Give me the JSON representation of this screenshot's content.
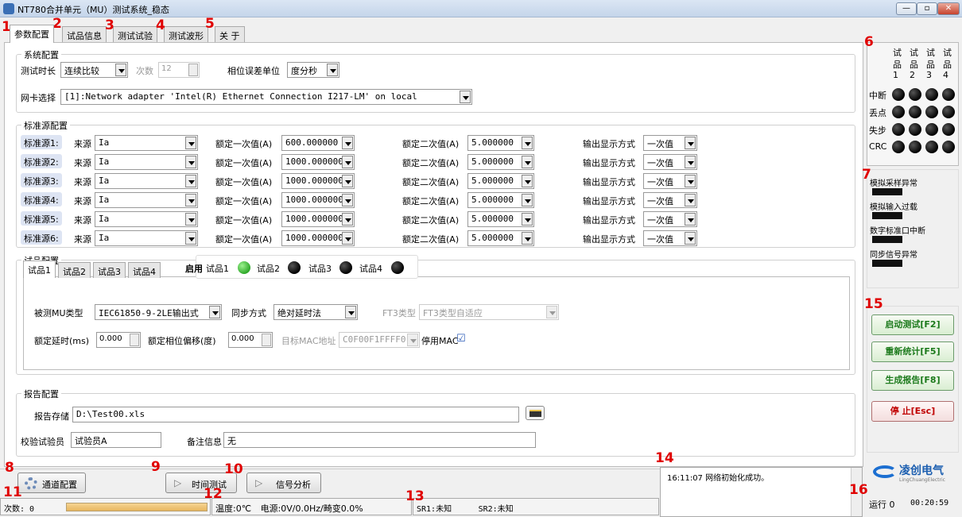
{
  "window": {
    "title": "NT780合并单元（MU）测试系统_稳态",
    "min": "—",
    "max": "▫",
    "close": "✕"
  },
  "tabs": [
    "参数配置",
    "试品信息",
    "测试试验",
    "测试波形",
    "关 于"
  ],
  "system": {
    "label": "系统配置",
    "duration_label": "测试时长",
    "duration_value": "连续比较",
    "count_label": "次数",
    "count_value": "12",
    "phase_unit_label": "相位误差单位",
    "phase_unit_value": "度分秒",
    "nic_label": "网卡选择",
    "nic_value": "[1]:Network adapter 'Intel(R) Ethernet Connection I217-LM' on local"
  },
  "std": {
    "label": "标准源配置",
    "src_label": "来源",
    "prim_label": "额定一次值(A)",
    "sec_label": "额定二次值(A)",
    "disp_label": "输出显示方式",
    "rows": [
      {
        "name": "标准源1:",
        "src": "Ia",
        "prim": "600.000000",
        "sec": "5.000000",
        "disp": "一次值"
      },
      {
        "name": "标准源2:",
        "src": "Ia",
        "prim": "1000.000000",
        "sec": "5.000000",
        "disp": "一次值"
      },
      {
        "name": "标准源3:",
        "src": "Ia",
        "prim": "1000.000000",
        "sec": "5.000000",
        "disp": "一次值"
      },
      {
        "name": "标准源4:",
        "src": "Ia",
        "prim": "1000.000000",
        "sec": "5.000000",
        "disp": "一次值"
      },
      {
        "name": "标准源5:",
        "src": "Ia",
        "prim": "1000.000000",
        "sec": "5.000000",
        "disp": "一次值"
      },
      {
        "name": "标准源6:",
        "src": "Ia",
        "prim": "1000.000000",
        "sec": "5.000000",
        "disp": "一次值"
      }
    ]
  },
  "sample": {
    "label": "试品配置",
    "tabs": [
      "试品1",
      "试品2",
      "试品3",
      "试品4"
    ],
    "enable_label": "启用",
    "enable_items": [
      "试品1",
      "试品2",
      "试品3",
      "试品4"
    ],
    "mu_type_label": "被测MU类型",
    "mu_type_value": "IEC61850-9-2LE输出式",
    "sync_label": "同步方式",
    "sync_value": "绝对延时法",
    "ft3_label": "FT3类型",
    "ft3_value": "FT3类型自适应",
    "delay_label": "额定延时(ms)",
    "delay_value": "0.000",
    "phase_label": "额定相位偏移(度)",
    "phase_value": "0.000",
    "mac_label": "目标MAC地址",
    "mac_value": "C0F00F1FFFF0",
    "mac_disable_label": "停用MAC",
    "mac_disable_check": "☑"
  },
  "report": {
    "label": "报告配置",
    "store_label": "报告存储",
    "store_value": "D:\\Test00.xls",
    "operator_label": "校验试验员",
    "operator_value": "试验员A",
    "note_label": "备注信息",
    "note_value": "无"
  },
  "right": {
    "header": [
      [
        "试",
        "品",
        "1"
      ],
      [
        "试",
        "品",
        "2"
      ],
      [
        "试",
        "品",
        "3"
      ],
      [
        "试",
        "品",
        "4"
      ]
    ],
    "rows": [
      "中断",
      "丢点",
      "失步",
      "CRC"
    ],
    "alarms": [
      "模拟采样异常",
      "模拟输入过载",
      "数字标准口中断",
      "同步信号异常"
    ],
    "buttons": [
      "启动测试[F2]",
      "重新统计[F5]",
      "生成报告[F8]",
      "停 止[Esc]"
    ]
  },
  "bottom": {
    "channel_btn": "通道配置",
    "time_btn": "时间测试",
    "signal_btn": "信号分析",
    "log": "16:11:07 网络初始化成功。",
    "logo_text": "凌创电气",
    "logo_sub": "LingChuangElectric",
    "run_label": "运行 0",
    "run_time": "00:20:59"
  },
  "status": {
    "count": "次数: 0",
    "temp": "温度:0℃",
    "power": "电源:0V/0.0Hz/畸变0.0%",
    "sr1": "SR1:未知",
    "sr2": "SR2:未知"
  },
  "markers": [
    "1",
    "2",
    "3",
    "4",
    "5",
    "6",
    "7",
    "8",
    "9",
    "10",
    "11",
    "12",
    "13",
    "14",
    "15",
    "16"
  ],
  "colors": {
    "marker": "#e00000",
    "ok": "#2fa82a",
    "accent_btn": "#1c7a1c",
    "stop_btn": "#c00000"
  }
}
